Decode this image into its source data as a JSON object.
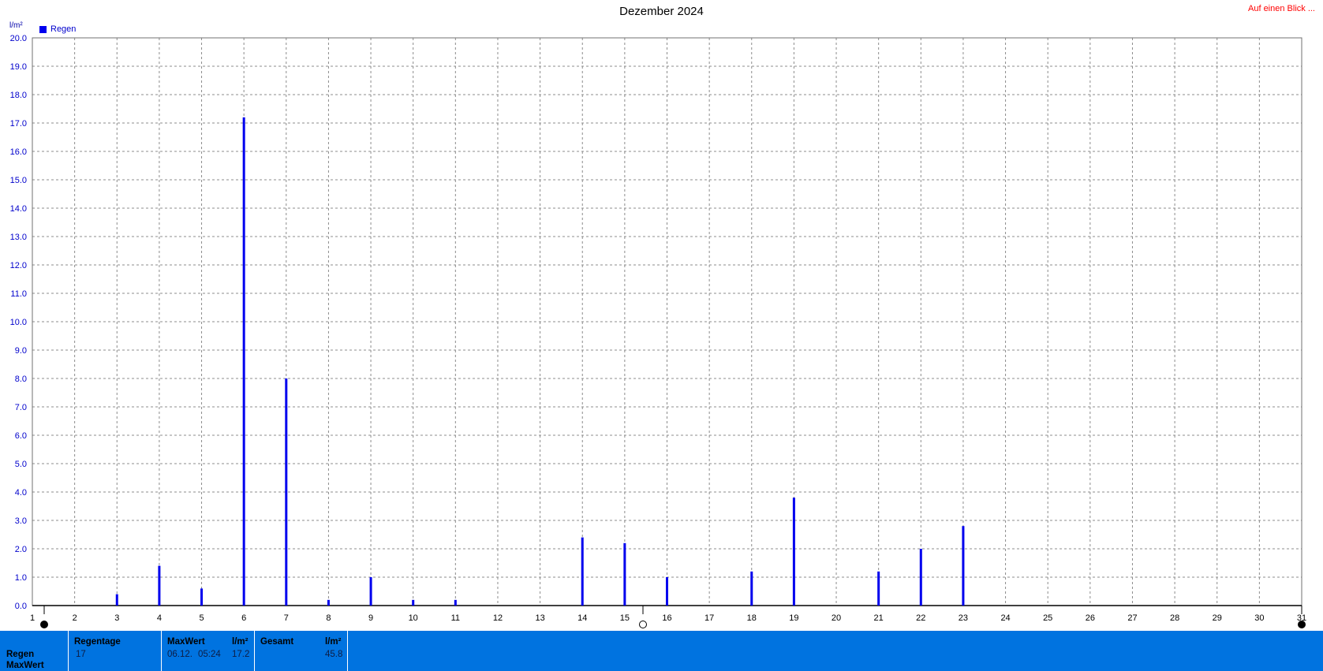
{
  "header": {
    "title": "Dezember 2024",
    "glance_link": "Auf einen Blick ...",
    "y_unit": "l/m²",
    "legend_label": "Regen"
  },
  "chart_data": {
    "type": "bar",
    "title": "Dezember 2024",
    "ylabel": "l/m²",
    "ylim": [
      0,
      20
    ],
    "yticks": [
      "0.0",
      "1.0",
      "2.0",
      "3.0",
      "4.0",
      "5.0",
      "6.0",
      "7.0",
      "8.0",
      "9.0",
      "10.0",
      "11.0",
      "12.0",
      "13.0",
      "14.0",
      "15.0",
      "16.0",
      "17.0",
      "18.0",
      "19.0",
      "20.0"
    ],
    "xlim": [
      1,
      31
    ],
    "xticks": [
      "1",
      "2",
      "3",
      "4",
      "5",
      "6",
      "7",
      "8",
      "9",
      "10",
      "11",
      "12",
      "13",
      "14",
      "15",
      "16",
      "17",
      "18",
      "19",
      "20",
      "21",
      "22",
      "23",
      "24",
      "25",
      "26",
      "27",
      "28",
      "29",
      "30",
      "31"
    ],
    "grid": true,
    "legend": "top-left",
    "series": [
      {
        "name": "Regen",
        "color": "#0000ee",
        "x": [
          3,
          4,
          5,
          6,
          7,
          8,
          9,
          10,
          11,
          14,
          15,
          16,
          18,
          19,
          21,
          22,
          23
        ],
        "values": [
          0.4,
          1.4,
          0.6,
          17.2,
          8.0,
          0.2,
          1.0,
          0.2,
          0.2,
          2.4,
          2.2,
          1.0,
          1.2,
          3.8,
          1.2,
          2.0,
          2.8
        ]
      }
    ]
  },
  "footer": {
    "row_label_1": "Regen",
    "row_label_2": "MaxWert",
    "regentage_label": "Regentage",
    "regentage_value": "17",
    "maxwert_label": "MaxWert",
    "maxwert_unit": "l/m²",
    "maxwert_date": "06.12.",
    "maxwert_time": "05:24",
    "maxwert_value": "17.2",
    "gesamt_label": "Gesamt",
    "gesamt_unit": "l/m²",
    "gesamt_value": "45.8"
  }
}
